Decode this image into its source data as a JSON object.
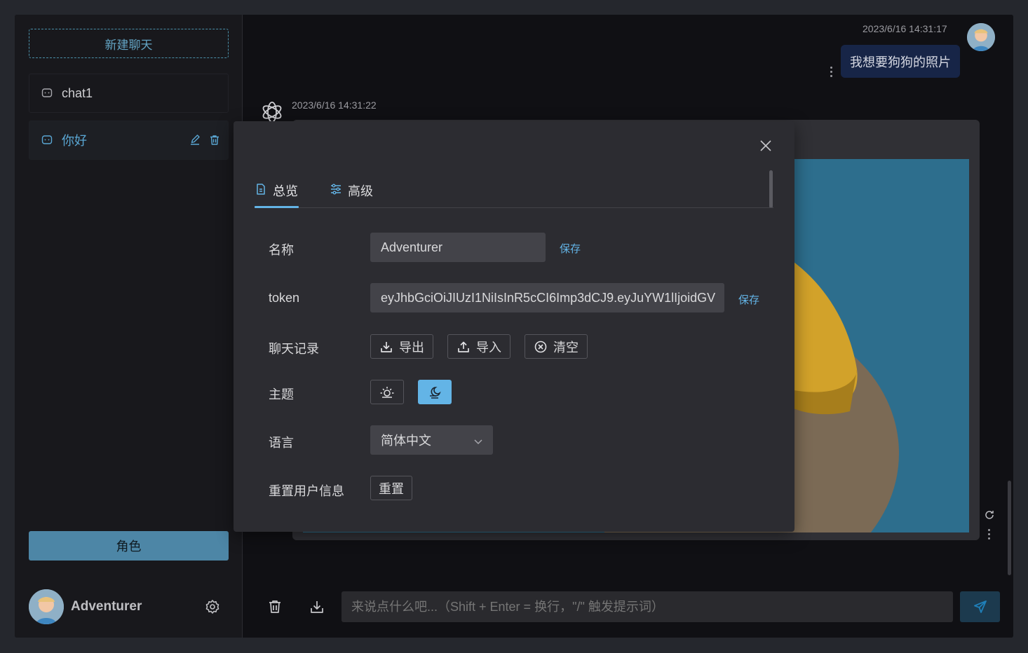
{
  "sidebar": {
    "new_chat_label": "新建聊天",
    "chats": [
      {
        "title": "chat1",
        "active": false
      },
      {
        "title": "你好",
        "active": true
      }
    ],
    "role_button_label": "角色",
    "user_name": "Adventurer"
  },
  "conversation": {
    "user_message": {
      "time": "2023/6/16 14:31:17",
      "text": "我想要狗狗的照片"
    },
    "bot_message": {
      "time": "2023/6/16 14:31:22"
    },
    "input_placeholder": "来说点什么吧...（Shift + Enter = 换行，\"/\" 触发提示词）"
  },
  "settings_modal": {
    "tabs": [
      {
        "label": "总览",
        "icon": "document-icon",
        "active": true
      },
      {
        "label": "高级",
        "icon": "sliders-icon",
        "active": false
      }
    ],
    "name": {
      "label": "名称",
      "value": "Adventurer",
      "save_label": "保存"
    },
    "token": {
      "label": "token",
      "value": "eyJhbGciOiJIUzI1NiIsInR5cCI6Imp3dCJ9.eyJuYW1lIjoidGV",
      "save_label": "保存"
    },
    "history": {
      "label": "聊天记录",
      "export_label": "导出",
      "import_label": "导入",
      "clear_label": "清空"
    },
    "theme": {
      "label": "主题",
      "selected": "dark"
    },
    "language": {
      "label": "语言",
      "value": "简体中文"
    },
    "reset": {
      "label": "重置用户信息",
      "button_label": "重置"
    }
  },
  "colors": {
    "accent": "#63b4e6",
    "role_button": "#4d86a6",
    "user_bubble": "#172547",
    "background": "#101014"
  }
}
